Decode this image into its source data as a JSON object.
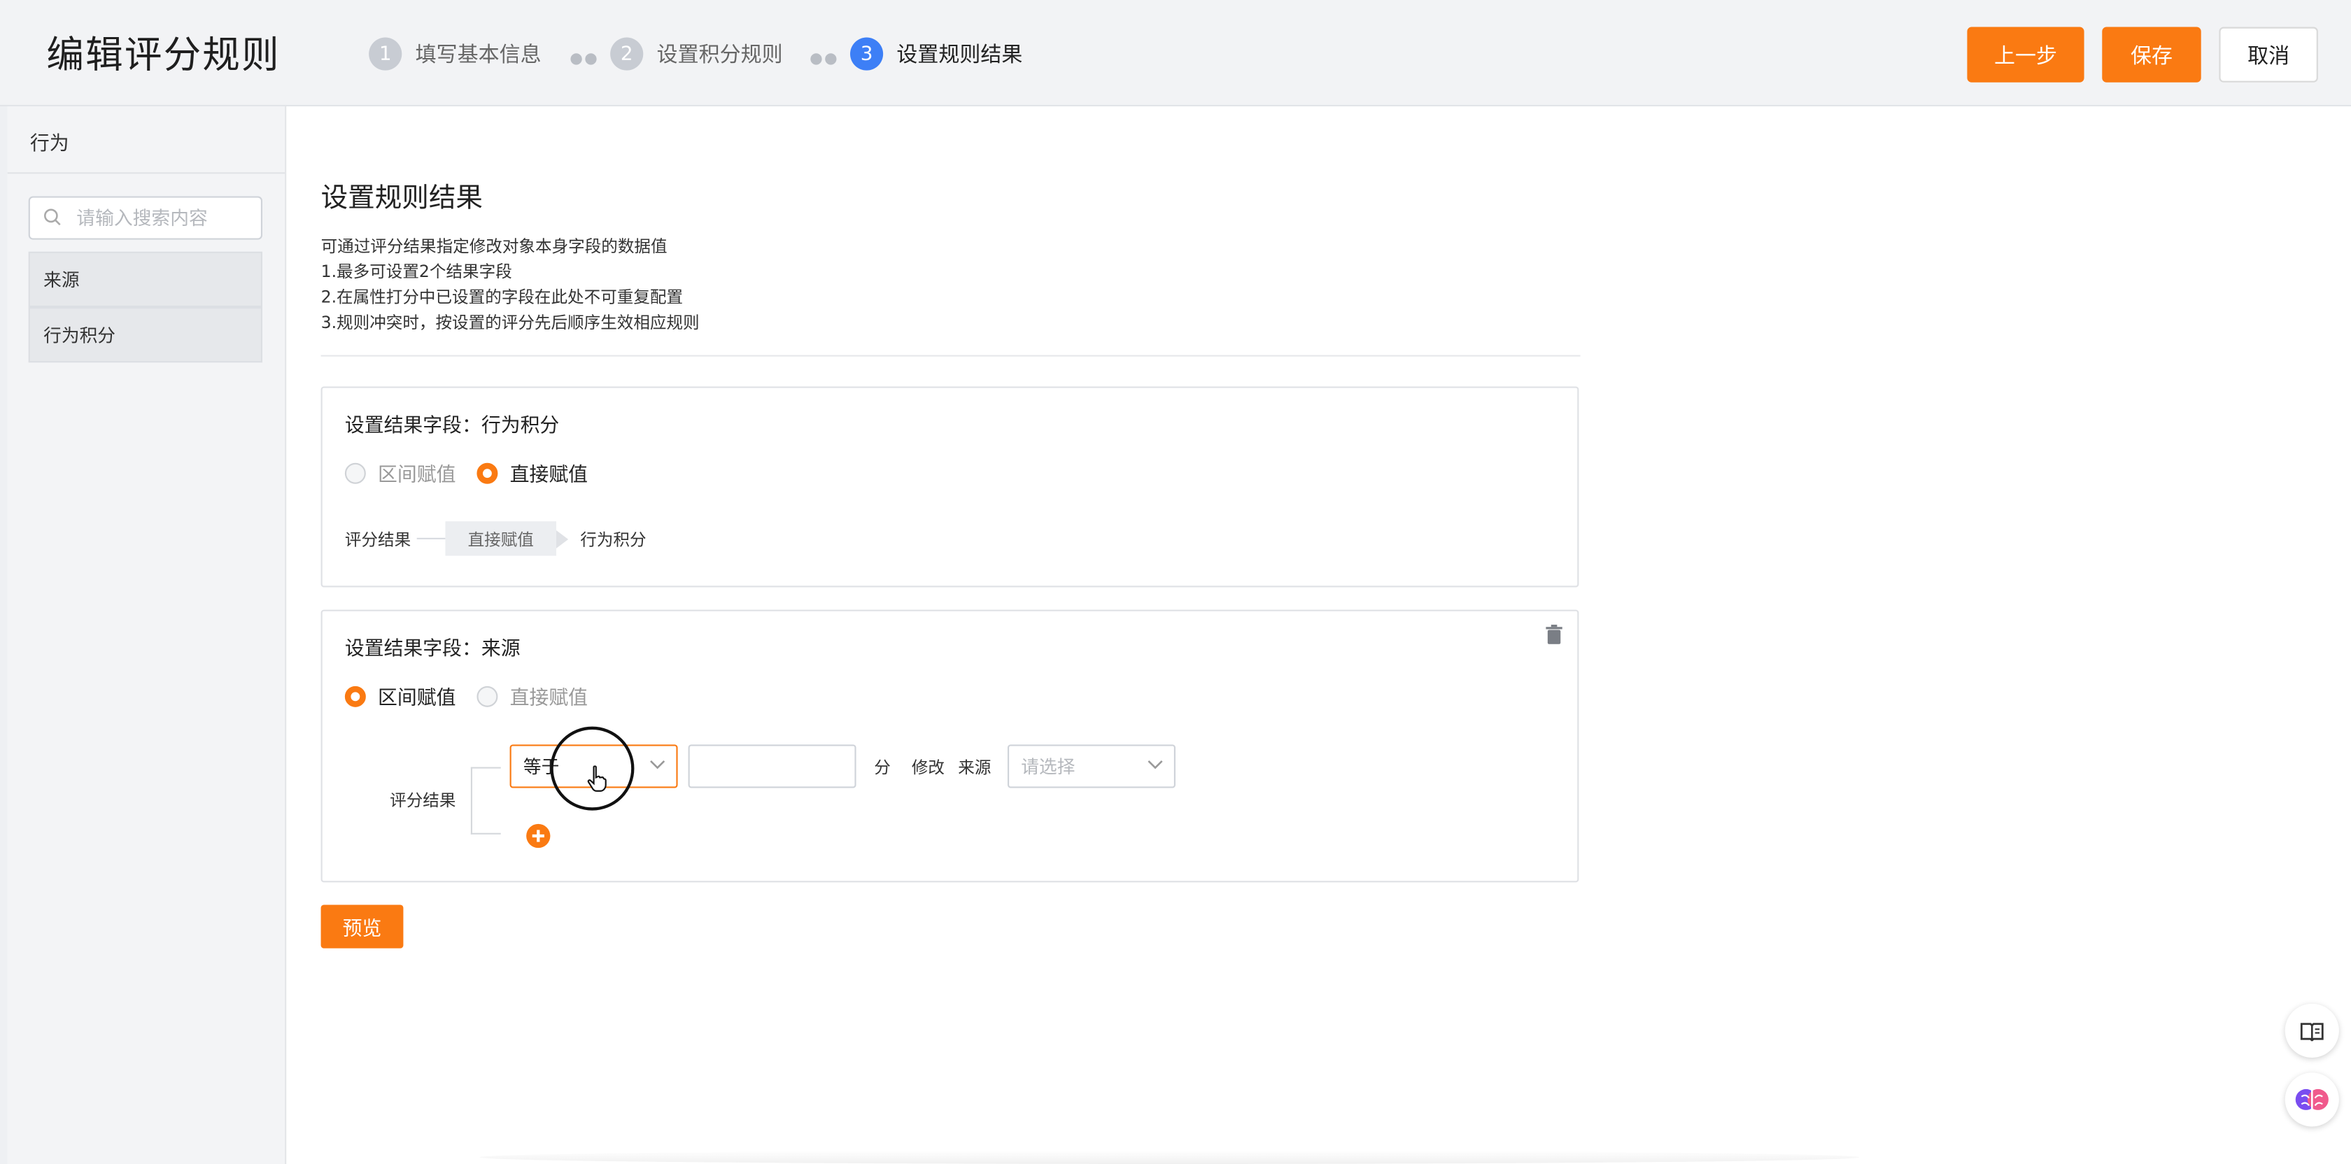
{
  "header": {
    "title": "编辑评分规则",
    "steps": [
      {
        "num": "1",
        "label": "填写基本信息"
      },
      {
        "num": "2",
        "label": "设置积分规则"
      },
      {
        "num": "3",
        "label": "设置规则结果"
      }
    ],
    "buttons": {
      "prev": "上一步",
      "save": "保存",
      "cancel": "取消"
    }
  },
  "sidebar": {
    "title": "行为",
    "search_placeholder": "请输入搜索内容",
    "items": [
      {
        "label": "来源"
      },
      {
        "label": "行为积分"
      }
    ]
  },
  "main": {
    "title": "设置规则结果",
    "description": [
      "可通过评分结果指定修改对象本身字段的数据值",
      "1.最多可设置2个结果字段",
      "2.在属性打分中已设置的字段在此处不可重复配置",
      "3.规则冲突时，按设置的评分先后顺序生效相应规则"
    ],
    "cards": [
      {
        "title": "设置结果字段：行为积分",
        "options": [
          "区间赋值",
          "直接赋值"
        ],
        "selected": "直接赋值",
        "flow": {
          "from": "评分结果",
          "mode": "直接赋值",
          "to": "行为积分"
        }
      },
      {
        "title": "设置结果字段：来源",
        "options": [
          "区间赋值",
          "直接赋值"
        ],
        "selected": "区间赋值",
        "range_label": "评分结果",
        "condition_value": "等于",
        "score_value": "",
        "unit": "分",
        "modify_label": "修改",
        "field_label": "来源",
        "target_placeholder": "请选择"
      }
    ],
    "preview_button": "预览"
  },
  "colors": {
    "accent": "#fa7a12",
    "step_active": "#3d7ff6"
  }
}
